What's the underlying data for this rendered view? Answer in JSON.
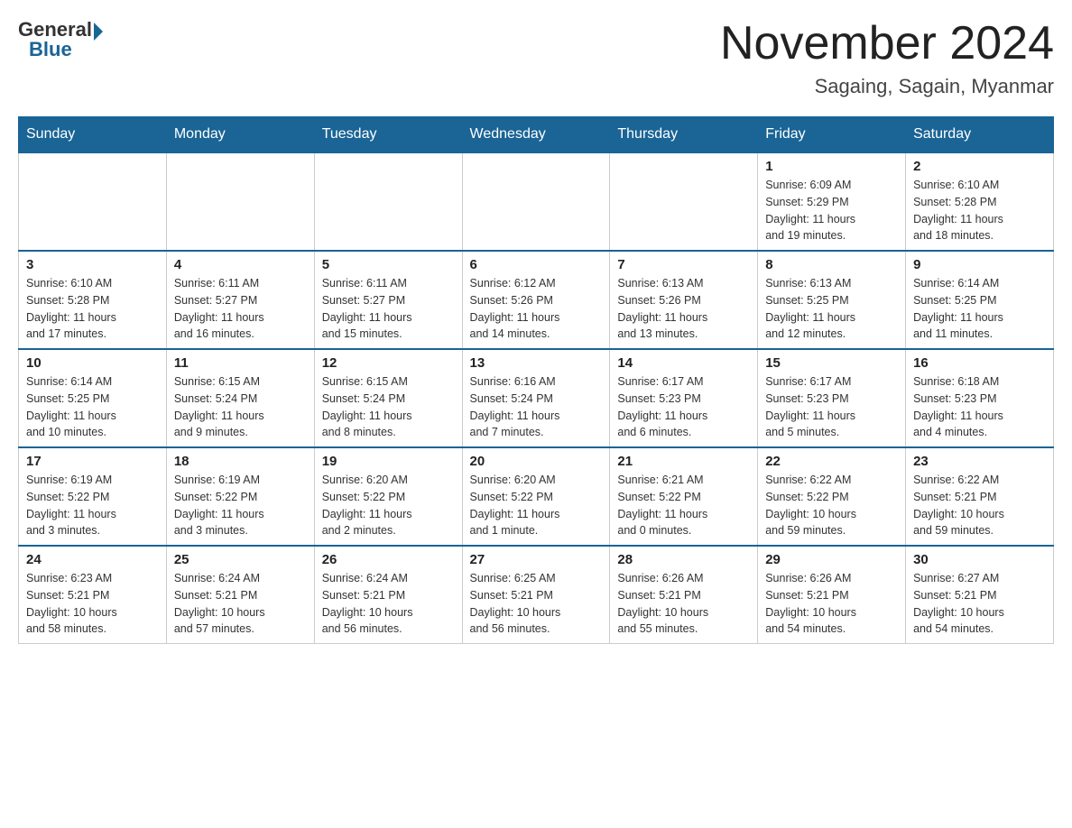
{
  "header": {
    "logo_general": "General",
    "logo_blue": "Blue",
    "month_title": "November 2024",
    "location": "Sagaing, Sagain, Myanmar"
  },
  "days_of_week": [
    "Sunday",
    "Monday",
    "Tuesday",
    "Wednesday",
    "Thursday",
    "Friday",
    "Saturday"
  ],
  "weeks": [
    {
      "days": [
        {
          "date": "",
          "info": ""
        },
        {
          "date": "",
          "info": ""
        },
        {
          "date": "",
          "info": ""
        },
        {
          "date": "",
          "info": ""
        },
        {
          "date": "",
          "info": ""
        },
        {
          "date": "1",
          "info": "Sunrise: 6:09 AM\nSunset: 5:29 PM\nDaylight: 11 hours\nand 19 minutes."
        },
        {
          "date": "2",
          "info": "Sunrise: 6:10 AM\nSunset: 5:28 PM\nDaylight: 11 hours\nand 18 minutes."
        }
      ]
    },
    {
      "days": [
        {
          "date": "3",
          "info": "Sunrise: 6:10 AM\nSunset: 5:28 PM\nDaylight: 11 hours\nand 17 minutes."
        },
        {
          "date": "4",
          "info": "Sunrise: 6:11 AM\nSunset: 5:27 PM\nDaylight: 11 hours\nand 16 minutes."
        },
        {
          "date": "5",
          "info": "Sunrise: 6:11 AM\nSunset: 5:27 PM\nDaylight: 11 hours\nand 15 minutes."
        },
        {
          "date": "6",
          "info": "Sunrise: 6:12 AM\nSunset: 5:26 PM\nDaylight: 11 hours\nand 14 minutes."
        },
        {
          "date": "7",
          "info": "Sunrise: 6:13 AM\nSunset: 5:26 PM\nDaylight: 11 hours\nand 13 minutes."
        },
        {
          "date": "8",
          "info": "Sunrise: 6:13 AM\nSunset: 5:25 PM\nDaylight: 11 hours\nand 12 minutes."
        },
        {
          "date": "9",
          "info": "Sunrise: 6:14 AM\nSunset: 5:25 PM\nDaylight: 11 hours\nand 11 minutes."
        }
      ]
    },
    {
      "days": [
        {
          "date": "10",
          "info": "Sunrise: 6:14 AM\nSunset: 5:25 PM\nDaylight: 11 hours\nand 10 minutes."
        },
        {
          "date": "11",
          "info": "Sunrise: 6:15 AM\nSunset: 5:24 PM\nDaylight: 11 hours\nand 9 minutes."
        },
        {
          "date": "12",
          "info": "Sunrise: 6:15 AM\nSunset: 5:24 PM\nDaylight: 11 hours\nand 8 minutes."
        },
        {
          "date": "13",
          "info": "Sunrise: 6:16 AM\nSunset: 5:24 PM\nDaylight: 11 hours\nand 7 minutes."
        },
        {
          "date": "14",
          "info": "Sunrise: 6:17 AM\nSunset: 5:23 PM\nDaylight: 11 hours\nand 6 minutes."
        },
        {
          "date": "15",
          "info": "Sunrise: 6:17 AM\nSunset: 5:23 PM\nDaylight: 11 hours\nand 5 minutes."
        },
        {
          "date": "16",
          "info": "Sunrise: 6:18 AM\nSunset: 5:23 PM\nDaylight: 11 hours\nand 4 minutes."
        }
      ]
    },
    {
      "days": [
        {
          "date": "17",
          "info": "Sunrise: 6:19 AM\nSunset: 5:22 PM\nDaylight: 11 hours\nand 3 minutes."
        },
        {
          "date": "18",
          "info": "Sunrise: 6:19 AM\nSunset: 5:22 PM\nDaylight: 11 hours\nand 3 minutes."
        },
        {
          "date": "19",
          "info": "Sunrise: 6:20 AM\nSunset: 5:22 PM\nDaylight: 11 hours\nand 2 minutes."
        },
        {
          "date": "20",
          "info": "Sunrise: 6:20 AM\nSunset: 5:22 PM\nDaylight: 11 hours\nand 1 minute."
        },
        {
          "date": "21",
          "info": "Sunrise: 6:21 AM\nSunset: 5:22 PM\nDaylight: 11 hours\nand 0 minutes."
        },
        {
          "date": "22",
          "info": "Sunrise: 6:22 AM\nSunset: 5:22 PM\nDaylight: 10 hours\nand 59 minutes."
        },
        {
          "date": "23",
          "info": "Sunrise: 6:22 AM\nSunset: 5:21 PM\nDaylight: 10 hours\nand 59 minutes."
        }
      ]
    },
    {
      "days": [
        {
          "date": "24",
          "info": "Sunrise: 6:23 AM\nSunset: 5:21 PM\nDaylight: 10 hours\nand 58 minutes."
        },
        {
          "date": "25",
          "info": "Sunrise: 6:24 AM\nSunset: 5:21 PM\nDaylight: 10 hours\nand 57 minutes."
        },
        {
          "date": "26",
          "info": "Sunrise: 6:24 AM\nSunset: 5:21 PM\nDaylight: 10 hours\nand 56 minutes."
        },
        {
          "date": "27",
          "info": "Sunrise: 6:25 AM\nSunset: 5:21 PM\nDaylight: 10 hours\nand 56 minutes."
        },
        {
          "date": "28",
          "info": "Sunrise: 6:26 AM\nSunset: 5:21 PM\nDaylight: 10 hours\nand 55 minutes."
        },
        {
          "date": "29",
          "info": "Sunrise: 6:26 AM\nSunset: 5:21 PM\nDaylight: 10 hours\nand 54 minutes."
        },
        {
          "date": "30",
          "info": "Sunrise: 6:27 AM\nSunset: 5:21 PM\nDaylight: 10 hours\nand 54 minutes."
        }
      ]
    }
  ]
}
